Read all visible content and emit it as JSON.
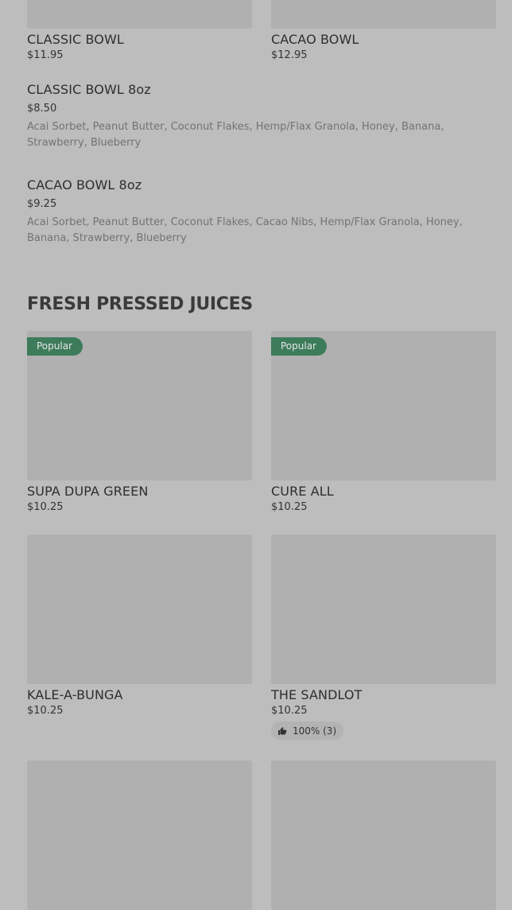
{
  "top_cards": [
    {
      "title": "CLASSIC BOWL",
      "price": "$11.95"
    },
    {
      "title": "CACAO BOWL",
      "price": "$12.95"
    }
  ],
  "list_items": [
    {
      "title": "CLASSIC BOWL 8oz",
      "price": "$8.50",
      "description": "Acai Sorbet, Peanut Butter, Coconut Flakes, Hemp/Flax Granola, Honey, Banana, Strawberry, Blueberry"
    },
    {
      "title": "CACAO BOWL 8oz",
      "price": "$9.25",
      "description": "Acai Sorbet, Peanut Butter, Coconut Flakes, Cacao Nibs, Hemp/Flax Granola, Honey, Banana, Strawberry, Blueberry"
    }
  ],
  "juices_section": {
    "title": "FRESH PRESSED JUICES",
    "badge_label": "Popular",
    "cards": [
      {
        "title": "SUPA DUPA GREEN",
        "price": "$10.25",
        "badge": "Popular"
      },
      {
        "title": "CURE ALL",
        "price": "$10.25",
        "badge": "Popular"
      },
      {
        "title": "KALE-A-BUNGA",
        "price": "$10.25"
      },
      {
        "title": "THE SANDLOT",
        "price": "$10.25",
        "rating": "100% (3)"
      }
    ]
  },
  "icons": {
    "rating_icon": "thumbs-up-icon"
  },
  "colors": {
    "background": "#bdbdbd",
    "image_placeholder": "#b0b0b0",
    "badge": "#3d7c5a"
  }
}
